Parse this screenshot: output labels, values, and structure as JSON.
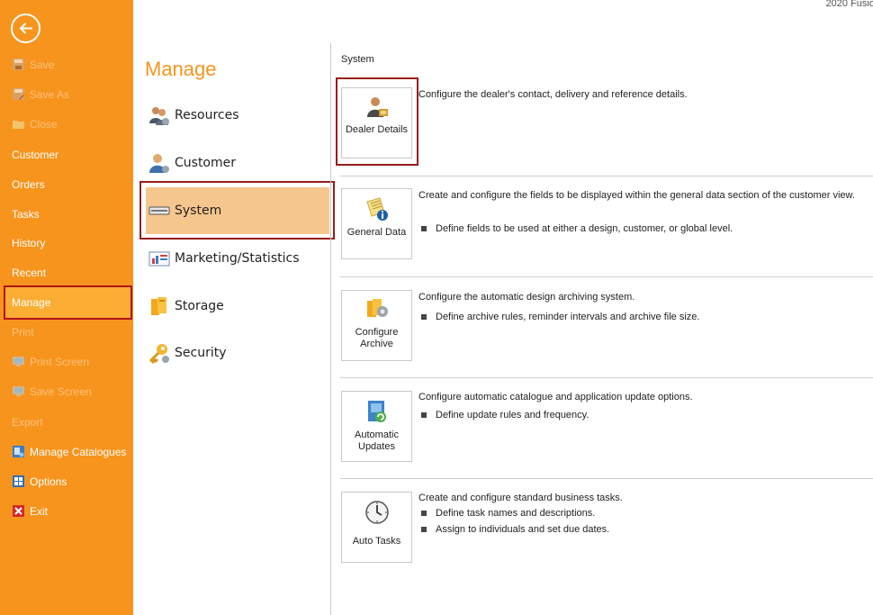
{
  "app_title": "2020 Fusio",
  "backstage": {
    "items": [
      {
        "label": "Save",
        "icon": "save-icon",
        "disabled": true
      },
      {
        "label": "Save As",
        "icon": "save-as-icon",
        "disabled": true
      },
      {
        "label": "Close",
        "icon": "folder-icon",
        "disabled": true
      },
      {
        "label": "Customer",
        "disabled": false
      },
      {
        "label": "Orders",
        "disabled": false
      },
      {
        "label": "Tasks",
        "disabled": false
      },
      {
        "label": "History",
        "disabled": false
      },
      {
        "label": "Recent",
        "disabled": false
      },
      {
        "label": "Manage",
        "disabled": false,
        "selected": true
      },
      {
        "label": "Print",
        "disabled": true
      },
      {
        "label": "Print Screen",
        "icon": "print-screen-icon",
        "disabled": true
      },
      {
        "label": "Save Screen",
        "icon": "save-screen-icon",
        "disabled": true
      },
      {
        "label": "Export",
        "disabled": true
      },
      {
        "label": "Manage Catalogues",
        "icon": "catalogue-icon",
        "disabled": false
      },
      {
        "label": "Options",
        "icon": "options-icon",
        "disabled": false
      },
      {
        "label": "Exit",
        "icon": "exit-icon",
        "disabled": false
      }
    ]
  },
  "manage": {
    "title": "Manage",
    "categories": [
      {
        "label": "Resources",
        "icon": "resources-icon"
      },
      {
        "label": "Customer",
        "icon": "customer-icon"
      },
      {
        "label": "System",
        "icon": "system-icon",
        "selected": true
      },
      {
        "label": "Marketing/Statistics",
        "icon": "chart-icon"
      },
      {
        "label": "Storage",
        "icon": "storage-icon"
      },
      {
        "label": "Security",
        "icon": "key-icon"
      }
    ]
  },
  "content": {
    "section_title": "System",
    "tiles": [
      {
        "label": "Dealer Details",
        "icon": "dealer-icon",
        "description": "Configure the dealer's contact, delivery and reference details.",
        "bullets": []
      },
      {
        "label": "General Data",
        "icon": "general-data-icon",
        "description": "Create and configure the fields to be displayed within the general data section of the customer view.",
        "bullets": [
          "Define fields to be used at either a design, customer, or global level."
        ]
      },
      {
        "label": "Configure Archive",
        "icon": "archive-icon",
        "description": "Configure the automatic design archiving system.",
        "bullets": [
          "Define archive rules, reminder intervals and archive file size."
        ]
      },
      {
        "label": "Automatic Updates",
        "icon": "update-icon",
        "description": "Configure automatic catalogue and application update options.",
        "bullets": [
          "Define update rules and frequency."
        ]
      },
      {
        "label": "Auto Tasks",
        "icon": "clock-icon",
        "description": "Create and configure standard business tasks.",
        "bullets": [
          "Define task names and descriptions.",
          "Assign to individuals and set due dates."
        ]
      }
    ]
  },
  "colors": {
    "accent": "#f7941d",
    "selected_menu": "#fbad34",
    "highlight_border": "#9a1c1c",
    "category_selected": "#f6c68f"
  }
}
